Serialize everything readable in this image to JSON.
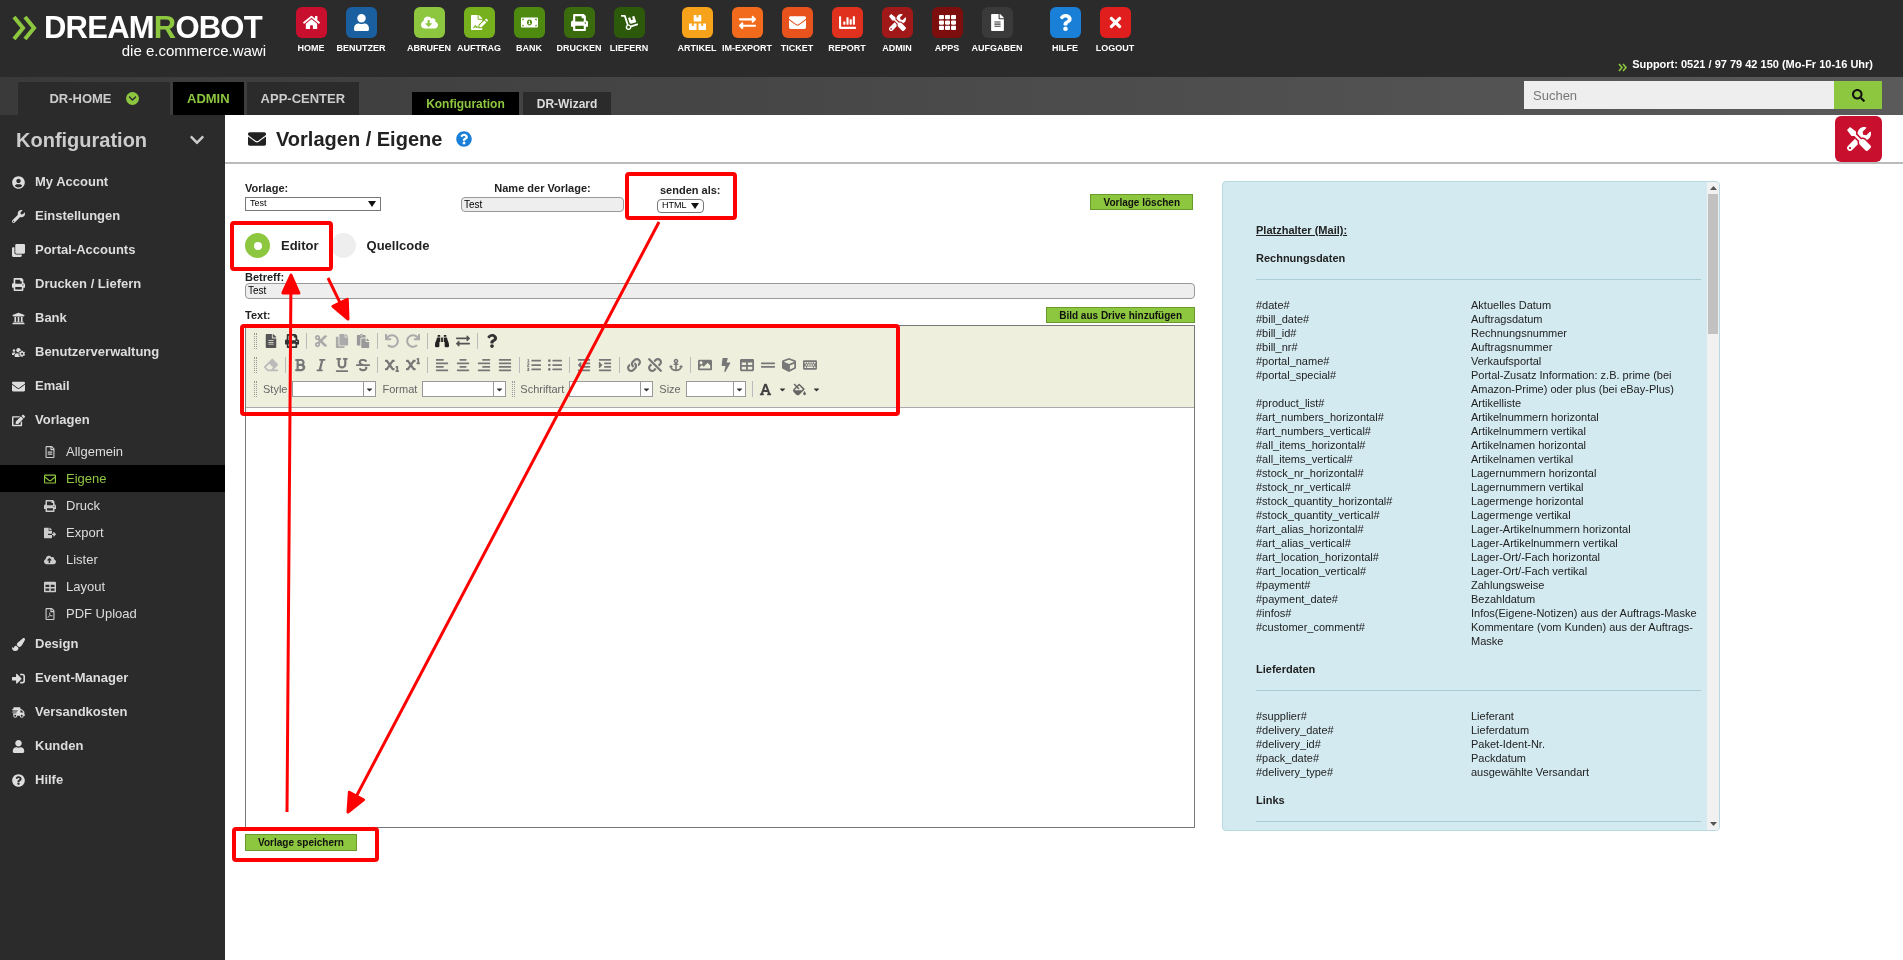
{
  "top_bar": {
    "logo": [
      "DREAM",
      "ROBOT"
    ],
    "tagline": "die e.commerce.wawi",
    "apps": [
      {
        "label": "HOME",
        "color": "#c8102e"
      },
      {
        "label": "BENUTZER",
        "color": "#1a5fa0"
      },
      {
        "label": "ABRUFEN",
        "color": "#8dc63f"
      },
      {
        "label": "AUFTRAG",
        "color": "#76b01c"
      },
      {
        "label": "BANK",
        "color": "#4f8a10"
      },
      {
        "label": "DRUCKEN",
        "color": "#3a6b0c"
      },
      {
        "label": "LIEFERN",
        "color": "#2d5a0a"
      },
      {
        "label": "ARTIKEL",
        "color": "#f7a21b"
      },
      {
        "label": "IM-EXPORT",
        "color": "#f26b1d"
      },
      {
        "label": "TICKET",
        "color": "#e8531d"
      },
      {
        "label": "REPORT",
        "color": "#e0301e"
      },
      {
        "label": "ADMIN",
        "color": "#a01818"
      },
      {
        "label": "APPS",
        "color": "#7d0e0e"
      },
      {
        "label": "AUFGABEN",
        "color": "#3a3a3a"
      },
      {
        "label": "HILFE",
        "color": "#1a7fd6"
      },
      {
        "label": "LOGOUT",
        "color": "#e01e1e"
      }
    ],
    "support": "Support: 0521 / 97 79 42 150 (Mo-Fr 10-16 Uhr)"
  },
  "nav": {
    "tabs": [
      {
        "label": "DR-HOME",
        "selected": false,
        "dropdown": true
      },
      {
        "label": "ADMIN",
        "selected": true,
        "dropdown": false
      },
      {
        "label": "APP-CENTER",
        "selected": false,
        "dropdown": false
      }
    ],
    "subtabs": [
      {
        "label": "Konfiguration",
        "selected": true
      },
      {
        "label": "DR-Wizard",
        "selected": false
      }
    ],
    "search": {
      "placeholder": "Suchen"
    }
  },
  "sidebar": {
    "title": "Konfiguration",
    "items": [
      {
        "label": "My Account",
        "selected": false
      },
      {
        "label": "Einstellungen",
        "selected": false
      },
      {
        "label": "Portal-Accounts",
        "selected": false
      },
      {
        "label": "Drucken / Liefern",
        "selected": false
      },
      {
        "label": "Bank",
        "selected": false
      },
      {
        "label": "Benutzerverwaltung",
        "selected": false
      },
      {
        "label": "Email",
        "selected": false
      },
      {
        "label": "Vorlagen",
        "selected": false,
        "children": [
          {
            "label": "Allgemein",
            "selected": false
          },
          {
            "label": "Eigene",
            "selected": true
          },
          {
            "label": "Druck",
            "selected": false
          },
          {
            "label": "Export",
            "selected": false
          },
          {
            "label": "Lister",
            "selected": false
          },
          {
            "label": "Layout",
            "selected": false
          },
          {
            "label": "PDF Upload",
            "selected": false
          }
        ]
      },
      {
        "label": "Design",
        "selected": false
      },
      {
        "label": "Event-Manager",
        "selected": false
      },
      {
        "label": "Versandkosten",
        "selected": false
      },
      {
        "label": "Kunden",
        "selected": false
      },
      {
        "label": "Hilfe",
        "selected": false
      }
    ]
  },
  "page": {
    "title": "Vorlagen / Eigene",
    "template": {
      "label": "Vorlage:",
      "value": "Test"
    },
    "name": {
      "label": "Name der Vorlage:",
      "value": "Test"
    },
    "send_as": {
      "label": "senden als:",
      "value": "HTML"
    },
    "delete_button": "Vorlage löschen",
    "modes": [
      {
        "label": "Editor",
        "selected": true
      },
      {
        "label": "Quellcode",
        "selected": false
      }
    ],
    "subject": {
      "label": "Betreff:",
      "value": "Test"
    },
    "text_label": "Text:",
    "drive_button": "Bild aus Drive hinzufügen",
    "toolbar_selects": [
      "Style",
      "Format",
      "Schriftart",
      "Size"
    ],
    "save_button": "Vorlage speichern"
  },
  "placeholders": {
    "title": "Platzhalter (Mail):",
    "sections": [
      {
        "heading": "Rechnungsdaten",
        "rows": [
          {
            "key": "#date#",
            "description": "Aktuelles Datum"
          },
          {
            "key": "#bill_date#",
            "description": "Auftragsdatum"
          },
          {
            "key": "#bill_id#",
            "description": "Rechnungsnummer"
          },
          {
            "key": "#bill_nr#",
            "description": "Auftragsnummer"
          },
          {
            "key": "#portal_name#",
            "description": "Verkaufsportal"
          },
          {
            "key": "#portal_special#",
            "description": "Portal-Zusatz Information: z.B. prime (bei Amazon-Prime) oder plus (bei eBay-Plus)"
          },
          {
            "key": "#product_list#",
            "description": "Artikelliste"
          },
          {
            "key": "#art_numbers_horizontal#",
            "description": "Artikelnummern horizontal"
          },
          {
            "key": "#art_numbers_vertical#",
            "description": "Artikelnummern vertikal"
          },
          {
            "key": "#all_items_horizontal#",
            "description": "Artikelnamen horizontal"
          },
          {
            "key": "#all_items_vertical#",
            "description": "Artikelnamen vertikal"
          },
          {
            "key": "#stock_nr_horizontal#",
            "description": "Lagernummern horizontal"
          },
          {
            "key": "#stock_nr_vertical#",
            "description": "Lagernummern vertikal"
          },
          {
            "key": "#stock_quantity_horizontal#",
            "description": "Lagermenge horizontal"
          },
          {
            "key": "#stock_quantity_vertical#",
            "description": "Lagermenge vertikal"
          },
          {
            "key": "#art_alias_horizontal#",
            "description": "Lager-Artikelnummern horizontal"
          },
          {
            "key": "#art_alias_vertical#",
            "description": "Lager-Artikelnummern vertikal"
          },
          {
            "key": "#art_location_horizontal#",
            "description": "Lager-Ort/-Fach horizontal"
          },
          {
            "key": "#art_location_vertical#",
            "description": "Lager-Ort/-Fach vertikal"
          },
          {
            "key": "#payment#",
            "description": "Zahlungsweise"
          },
          {
            "key": "#payment_date#",
            "description": "Bezahldatum"
          },
          {
            "key": "#infos#",
            "description": "Infos(Eigene-Notizen) aus der Auftrags-Maske"
          },
          {
            "key": "#customer_comment#",
            "description": "Kommentare (vom Kunden) aus der Auftrags-Maske"
          }
        ]
      },
      {
        "heading": "Lieferdaten",
        "rows": [
          {
            "key": "#supplier#",
            "description": "Lieferant"
          },
          {
            "key": "#delivery_date#",
            "description": "Lieferdatum"
          },
          {
            "key": "#delivery_id#",
            "description": "Paket-Ident-Nr."
          },
          {
            "key": "#pack_date#",
            "description": "Packdatum"
          },
          {
            "key": "#delivery_type#",
            "description": "ausgewählte Versandart"
          }
        ]
      },
      {
        "heading": "Links"
      }
    ]
  }
}
